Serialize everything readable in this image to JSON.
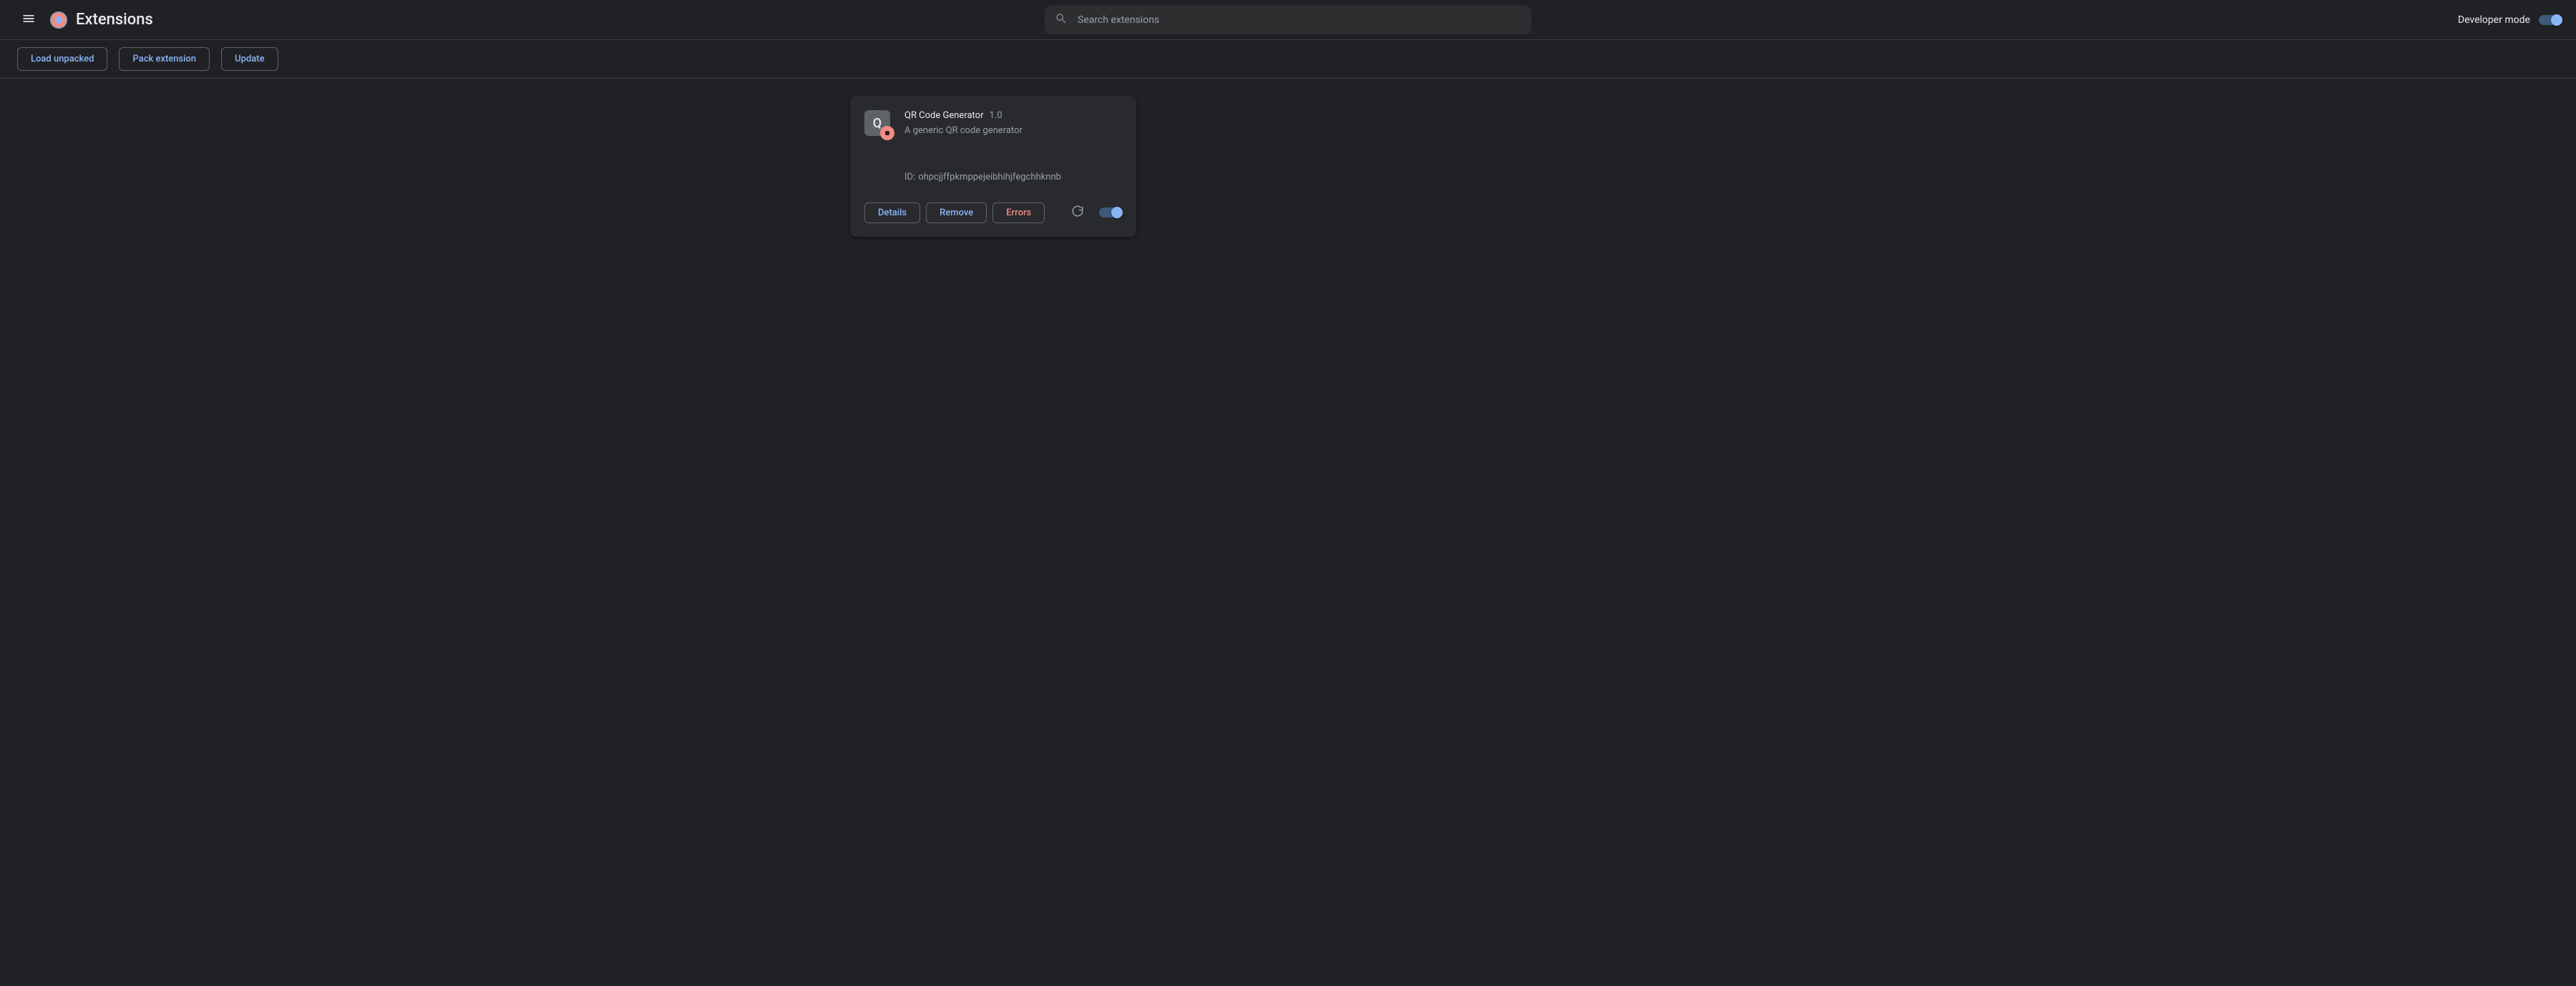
{
  "header": {
    "title": "Extensions",
    "search_placeholder": "Search extensions",
    "developer_mode_label": "Developer mode",
    "developer_mode_on": true
  },
  "dev_toolbar": {
    "load_unpacked": "Load unpacked",
    "pack_extension": "Pack extension",
    "update": "Update"
  },
  "extensions": [
    {
      "icon_letter": "Q",
      "name": "QR Code Generator",
      "version": "1.0",
      "description": "A generic QR code generator",
      "id_prefix": "ID:",
      "id": "ohpcjjffpkmppejeibhihjfegchhknnb",
      "has_errors": true,
      "enabled": true,
      "buttons": {
        "details": "Details",
        "remove": "Remove",
        "errors": "Errors"
      }
    }
  ]
}
